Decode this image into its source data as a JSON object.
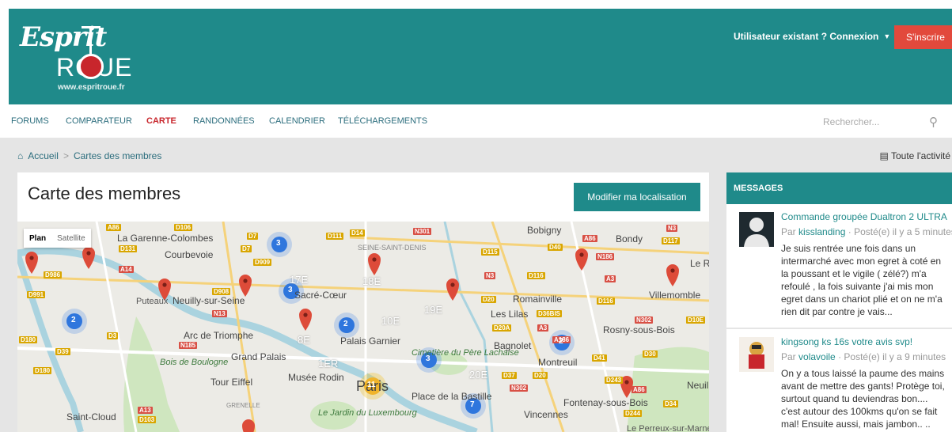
{
  "header": {
    "logo_line1": "Esprit",
    "logo_line2": "ROUE",
    "logo_url": "www.espritroue.fr",
    "user_menu": "Utilisateur existant ? Connexion",
    "signup": "S'inscrire"
  },
  "nav": {
    "items": [
      "FORUMS",
      "COMPARATEUR",
      "CARTE",
      "RANDONNÉES",
      "CALENDRIER",
      "TÉLÉCHARGEMENTS"
    ],
    "active": "CARTE",
    "search_placeholder": "Rechercher..."
  },
  "breadcrumb": {
    "home": "Accueil",
    "sep": ">",
    "current": "Cartes des membres"
  },
  "activity": "Toute l'activité",
  "page": {
    "title": "Carte des membres",
    "edit_button": "Modifier ma localisation"
  },
  "map": {
    "type_plan": "Plan",
    "type_satellite": "Satellite",
    "places": [
      "La Garenne-Colombes",
      "Courbevoie",
      "Puteaux",
      "Neuilly-sur-Seine",
      "Arc de Triomphe",
      "Bois de Boulogne",
      "Tour Eiffel",
      "Saint-Cloud",
      "Sacré-Cœur",
      "Palais Garnier",
      "Grand Palais",
      "Musée Rodin",
      "Le Jardin du Luxembourg",
      "Paris",
      "Place de la Bastille",
      "Cimetière du Père Lachaise",
      "Bobigny",
      "Bondy",
      "Romainville",
      "Les Lilas",
      "Bagnolet",
      "Montreuil",
      "Rosny-sous-Bois",
      "Villemomble",
      "Fontenay-sous-Bois",
      "Vincennes",
      "Neuilly",
      "Le Perreux-sur-Marne",
      "SEINE-SAINT-DENIS",
      "GRENELLE",
      "Le Ra"
    ],
    "arrondissements": [
      "17E",
      "18E",
      "8E",
      "10E",
      "19E",
      "1ER",
      "20E"
    ],
    "clusters": [
      "3",
      "3",
      "2",
      "2",
      "3",
      "2",
      "11",
      "7"
    ]
  },
  "sidebar": {
    "heading": "MESSAGES",
    "messages": [
      {
        "title": "Commande groupée Dualtron 2 ULTRA",
        "by_prefix": "Par",
        "author": "kisslanding",
        "posted": "· Posté(e) il y a 5 minutes",
        "body": "Je suis rentrée une fois dans un intermarché avec mon egret à coté en la poussant et le vigile ( zélé?) m'a refoulé , la fois suivante j'ai mis mon egret dans un chariot plié et on ne m'a rien dit par contre je vais..."
      },
      {
        "title": "kingsong ks 16s votre avis svp!",
        "by_prefix": "Par",
        "author": "volavoile",
        "posted": "· Posté(e) il y a 9 minutes",
        "body": "On y a tous laissé la paume des mains avant de mettre des gants! Protège toi, surtout quand tu deviendras bon.... c'est autour des 100kms qu'on se fait mal! Ensuite aussi, mais jambon.. .."
      }
    ]
  },
  "colors": {
    "brand": "#1f8a8a",
    "accent": "#c8262c",
    "signup": "#e2493c"
  }
}
